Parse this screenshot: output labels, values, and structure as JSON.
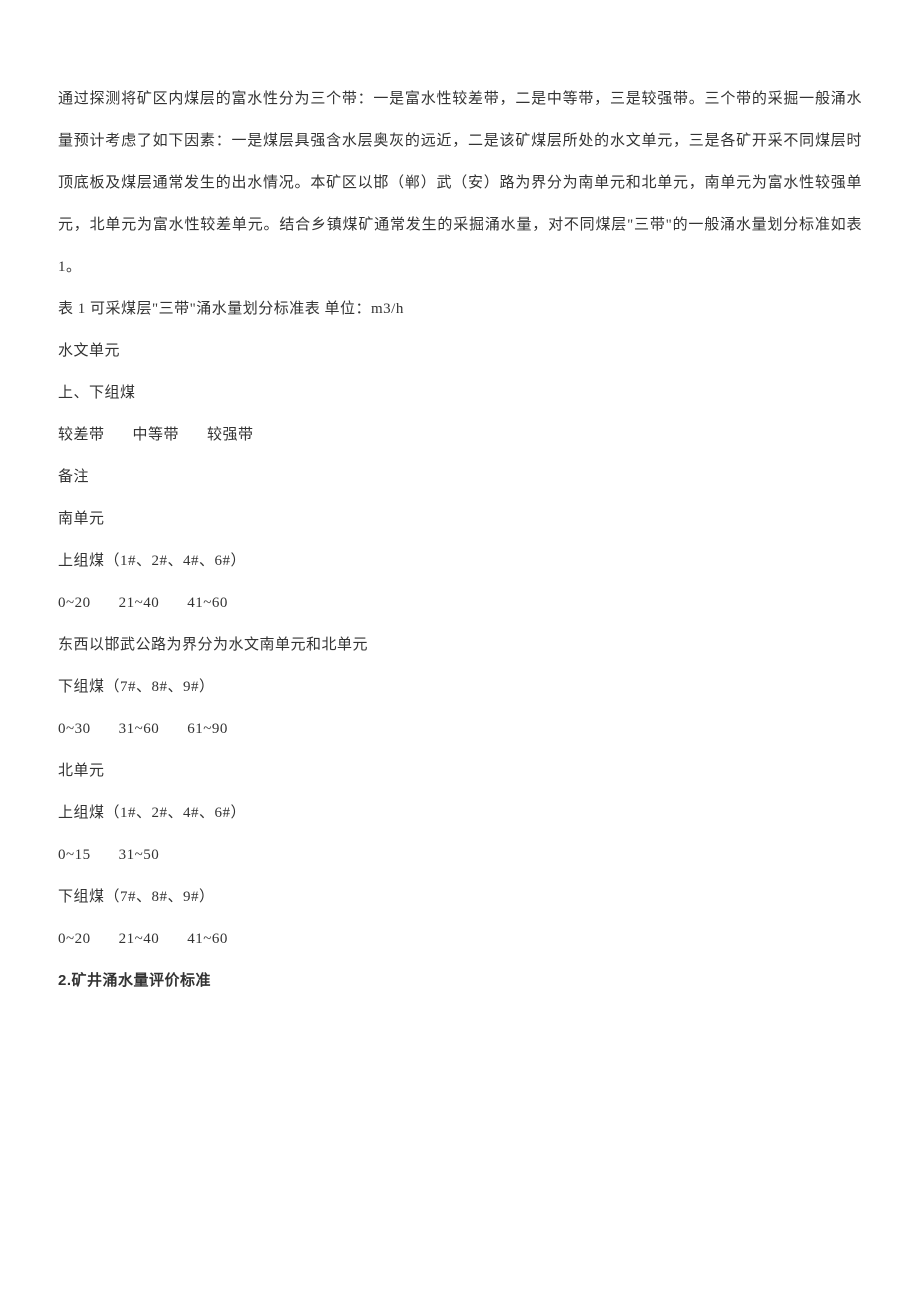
{
  "paragraph": "通过探测将矿区内煤层的富水性分为三个带：一是富水性较差带，二是中等带，三是较强带。三个带的采掘一般涌水量预计考虑了如下因素：一是煤层具强含水层奥灰的远近，二是该矿煤层所处的水文单元，三是各矿开采不同煤层时顶底板及煤层通常发生的出水情况。本矿区以邯（郸）武（安）路为界分为南单元和北单元，南单元为富水性较强单元，北单元为富水性较差单元。结合乡镇煤矿通常发生的采掘涌水量，对不同煤层\"三带\"的一般涌水量划分标准如表 1。",
  "table_caption": "表 1  可采煤层\"三带\"涌水量划分标准表  单位：m3/h",
  "header": {
    "h1": "水文单元",
    "h2": "上、下组煤",
    "zones": {
      "poor": "较差带",
      "medium": "中等带",
      "strong": "较强带"
    },
    "note": "备注"
  },
  "rows": {
    "south": "南单元",
    "upper_group_label": "上组煤（1#、2#、4#、6#）",
    "south_upper": {
      "poor": "0~20",
      "medium": "21~40",
      "strong": "41~60"
    },
    "notes_text": "东西以邯武公路为界分为水文南单元和北单元",
    "lower_group_label": "下组煤（7#、8#、9#）",
    "south_lower": {
      "poor": "0~30",
      "medium": "31~60",
      "strong": "61~90"
    },
    "north": "北单元",
    "north_upper": {
      "poor": "0~15",
      "strong": "31~50"
    },
    "north_lower": {
      "poor": "0~20",
      "medium": "21~40",
      "strong": "41~60"
    }
  },
  "heading": {
    "num": "2.",
    "text": "矿井涌水量评价标准"
  }
}
